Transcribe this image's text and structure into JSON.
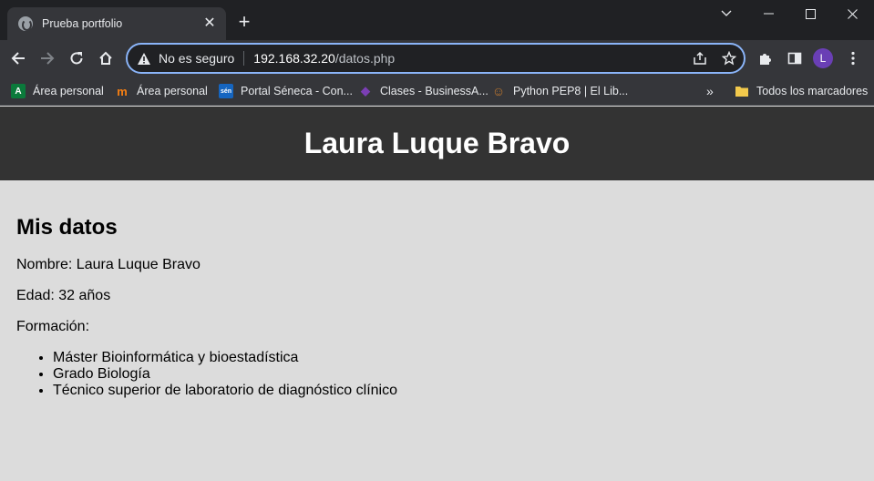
{
  "browser": {
    "tab": {
      "title": "Prueba portfolio",
      "close": "✕"
    },
    "new_tab": "+",
    "window_controls": {
      "minimize": "─",
      "maximize": "☐",
      "close": "✕",
      "dropdown": "⌄"
    },
    "address_bar": {
      "security_text": "No es seguro",
      "url_host": "192.168.32.20",
      "url_path": "/datos.php"
    },
    "profile_initial": "L",
    "bookmarks": [
      {
        "label": "Área personal",
        "icon": "junta-andalucia-icon",
        "icon_glyph": "A",
        "icon_color": "#0b7a3b"
      },
      {
        "label": "Área personal",
        "icon": "moodle-icon",
        "icon_glyph": "m",
        "icon_color": "#f98012"
      },
      {
        "label": "Portal Séneca - Con...",
        "icon": "seneca-icon",
        "icon_glyph": "sén",
        "icon_color": "#1565c0"
      },
      {
        "label": "Clases - BusinessA...",
        "icon": "businessacademy-icon",
        "icon_glyph": "◆",
        "icon_color": "#7b3fb5"
      },
      {
        "label": "Python PEP8 | El Lib...",
        "icon": "python-book-icon",
        "icon_glyph": "☺",
        "icon_color": "#c0792f"
      }
    ],
    "bookmarks_overflow": "»",
    "all_bookmarks": "Todos los marcadores"
  },
  "page": {
    "header_title": "Laura Luque Bravo",
    "section_title": "Mis datos",
    "name_line": "Nombre: Laura Luque Bravo",
    "age_line": "Edad: 32 años",
    "education_label": "Formación:",
    "education": [
      "Máster Bioinformática y bioestadística",
      "Grado Biología",
      "Técnico superior de laboratorio de diagnóstico clínico"
    ]
  }
}
